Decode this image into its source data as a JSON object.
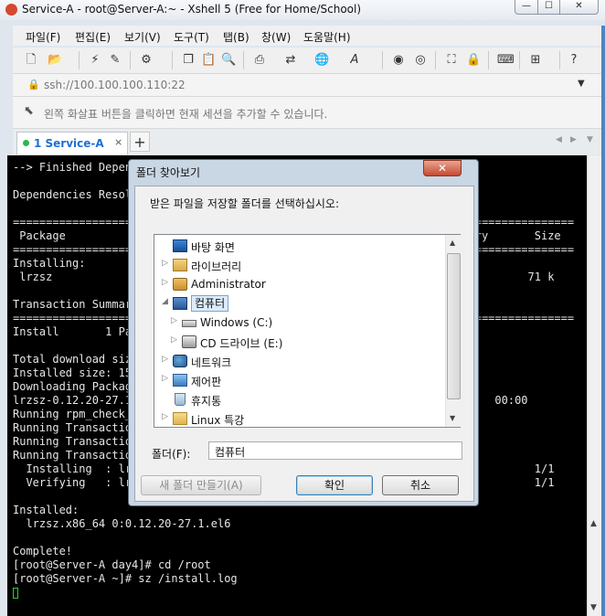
{
  "window": {
    "title": "Service-A - root@Server-A:~ - Xshell 5 (Free for Home/School)"
  },
  "window_controls": {
    "minimize": "—",
    "maximize": "☐",
    "close": "✕"
  },
  "menu": [
    "파일(F)",
    "편집(E)",
    "보기(V)",
    "도구(T)",
    "탭(B)",
    "창(W)",
    "도움말(H)"
  ],
  "address": "ssh://100.100.100.110:22",
  "hint": "왼쪽 화살표 버튼을 클릭하면 현재 세션을 추가할 수 있습니다.",
  "tab": {
    "label": "1 Service-A",
    "close": "×",
    "add": "+"
  },
  "terminal": {
    "lines": [
      "--> Finished Depen",
      "",
      "Dependencies Resol",
      "",
      "==================                                                 ==================",
      " Package                                                             ory       Size",
      "==================                                                 ==================",
      "Installing:",
      " lrzsz                                                                        71 k",
      "",
      "Transaction Summar",
      "==================                                                 ==================",
      "Install       1 Pa",
      "",
      "Total download siz",
      "Installed size: 15",
      "Downloading Packag",
      "lrzsz-0.12.20-27.1                                                       00:00",
      "Running rpm_check_",
      "Running Transactio",
      "Running Transaction Test S",
      "Running Transactio",
      "  Installing  : lrz                                                            1/1",
      "  Verifying   : lrz                                                            1/1",
      "",
      "Installed:",
      "  lrzsz.x86_64 0:0.12.20-27.1.el6",
      "",
      "Complete!",
      "[root@Server-A day4]# cd /root",
      "[root@Server-A ~]# sz /install.log"
    ]
  },
  "dialog": {
    "title": "폴더 찾아보기",
    "close": "✕",
    "prompt": "받은 파일을 저장할 폴더를 선택하십시오:",
    "tree": [
      {
        "label": "바탕 화면",
        "depth": 0,
        "expander": "",
        "icon": "desktop-icon"
      },
      {
        "label": "라이브러리",
        "depth": 0,
        "expander": "▷",
        "icon": "library-icon"
      },
      {
        "label": "Administrator",
        "depth": 0,
        "expander": "▷",
        "icon": "user-folder-icon"
      },
      {
        "label": "컴퓨터",
        "depth": 0,
        "expander": "◢",
        "icon": "computer-icon",
        "selected": true
      },
      {
        "label": "Windows (C:)",
        "depth": 1,
        "expander": "▷",
        "icon": "hard-drive-icon"
      },
      {
        "label": "CD 드라이브 (E:)",
        "depth": 1,
        "expander": "▷",
        "icon": "cd-drive-icon"
      },
      {
        "label": "네트워크",
        "depth": 0,
        "expander": "▷",
        "icon": "network-icon"
      },
      {
        "label": "제어판",
        "depth": 0,
        "expander": "▷",
        "icon": "control-panel-icon"
      },
      {
        "label": "휴지통",
        "depth": 0,
        "expander": "",
        "icon": "recycle-bin-icon"
      },
      {
        "label": "Linux 특강",
        "depth": 0,
        "expander": "▷",
        "icon": "folder-icon"
      }
    ],
    "folder_label": "폴더(F):",
    "folder_value": "컴퓨터",
    "new_folder": "새 폴더 만들기(A)",
    "ok": "확인",
    "cancel": "취소"
  }
}
